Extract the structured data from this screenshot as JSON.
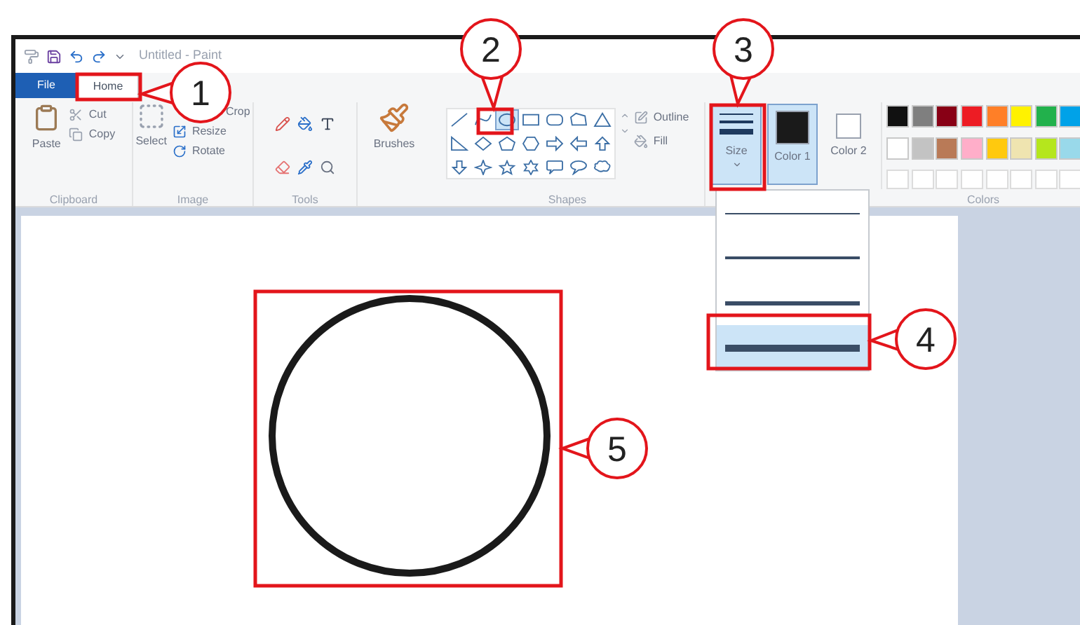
{
  "window": {
    "title": "Untitled - Paint"
  },
  "tabs": [
    {
      "label": "File",
      "kind": "file",
      "selected": false
    },
    {
      "label": "Home",
      "kind": "tab",
      "selected": true
    }
  ],
  "ribbon": {
    "clipboard": {
      "paste": "Paste",
      "cut": "Cut",
      "copy": "Copy",
      "label": "Clipboard"
    },
    "image": {
      "select": "Select",
      "crop": "Crop",
      "resize": "Resize",
      "rotate": "Rotate",
      "label": "Image"
    },
    "tools": {
      "label": "Tools"
    },
    "brushes": {
      "label": "Brushes"
    },
    "shapes": {
      "items": [
        {
          "kind": "line",
          "selected": false
        },
        {
          "kind": "curve",
          "selected": false
        },
        {
          "kind": "oval",
          "selected": true
        },
        {
          "kind": "rectangle",
          "selected": false
        },
        {
          "kind": "rounded-rectangle",
          "selected": false
        },
        {
          "kind": "polygon",
          "selected": false
        },
        {
          "kind": "triangle",
          "selected": false
        },
        {
          "kind": "right-triangle",
          "selected": false
        },
        {
          "kind": "diamond",
          "selected": false
        },
        {
          "kind": "pentagon",
          "selected": false
        },
        {
          "kind": "hexagon",
          "selected": false
        },
        {
          "kind": "arrow-right",
          "selected": false
        },
        {
          "kind": "arrow-left",
          "selected": false
        },
        {
          "kind": "arrow-up",
          "selected": false
        },
        {
          "kind": "arrow-down",
          "selected": false
        },
        {
          "kind": "star4",
          "selected": false
        },
        {
          "kind": "star5",
          "selected": false
        },
        {
          "kind": "star6",
          "selected": false
        },
        {
          "kind": "callout-rounded",
          "selected": false
        },
        {
          "kind": "callout-oval",
          "selected": false
        },
        {
          "kind": "callout-cloud",
          "selected": false
        }
      ],
      "outline": "Outline",
      "fill": "Fill",
      "label": "Shapes"
    },
    "size": {
      "label": "Size",
      "selected": true
    },
    "color1": {
      "label": "Color 1",
      "color": "#1a1a1a",
      "selected": true
    },
    "color2": {
      "label": "Color 2",
      "color": "#ffffff",
      "selected": false
    },
    "colors": {
      "label": "Colors",
      "swatches": [
        {
          "color": "#111111"
        },
        {
          "color": "#7f7f7f"
        },
        {
          "color": "#880015"
        },
        {
          "color": "#ed1c24"
        },
        {
          "color": "#ff7f27"
        },
        {
          "color": "#fff200"
        },
        {
          "color": "#22b14c"
        },
        {
          "color": "#00a2e8"
        },
        {
          "color": "#ffffff"
        },
        {
          "color": "#c3c3c3"
        },
        {
          "color": "#b97a57"
        },
        {
          "color": "#ffaec9"
        },
        {
          "color": "#ffc90e"
        },
        {
          "color": "#efe4b0"
        },
        {
          "color": "#b5e61d"
        },
        {
          "color": "#99d9ea"
        }
      ]
    }
  },
  "size_menu": [
    {
      "kind": "thin",
      "selected": false
    },
    {
      "kind": "medium",
      "selected": false
    },
    {
      "kind": "thick",
      "selected": false
    },
    {
      "kind": "heavy",
      "selected": true
    }
  ],
  "callouts": [
    {
      "label": "1"
    },
    {
      "label": "2"
    },
    {
      "label": "3"
    },
    {
      "label": "4"
    },
    {
      "label": "5"
    }
  ]
}
